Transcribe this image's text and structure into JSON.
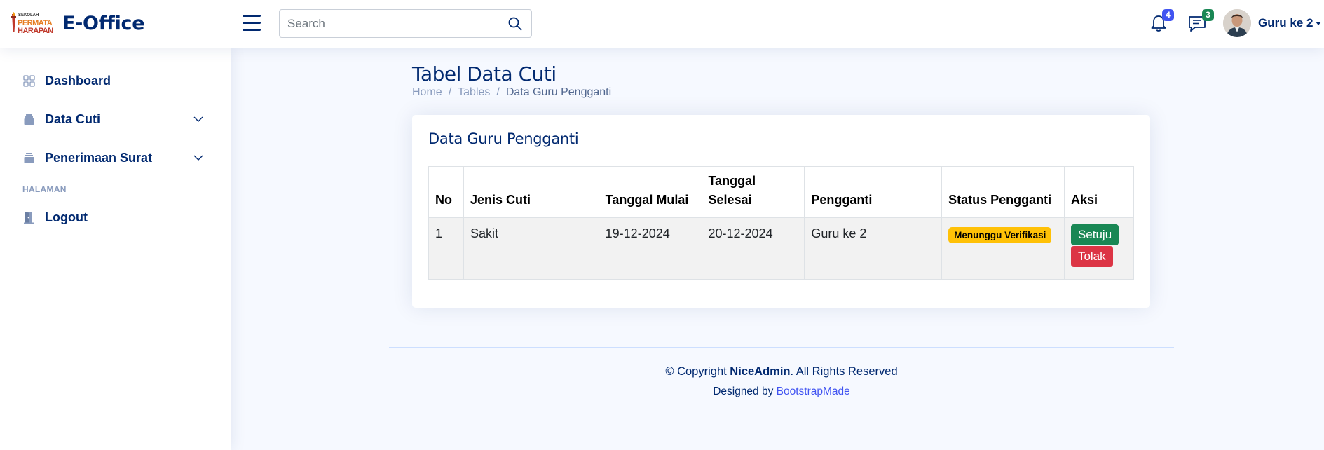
{
  "header": {
    "brand": "E-Office",
    "logo_top": "SEKOLAH",
    "logo_mid": "PERMATA",
    "logo_bottom": "HARAPAN",
    "search_placeholder": "Search",
    "notifications_count": "4",
    "messages_count": "3",
    "user_name": "Guru ke 2"
  },
  "sidebar": {
    "items": [
      {
        "label": "Dashboard",
        "icon": "grid-icon"
      },
      {
        "label": "Data Cuti",
        "icon": "layers-icon"
      },
      {
        "label": "Penerimaan Surat",
        "icon": "layers-icon"
      }
    ],
    "heading": "HALAMAN",
    "logout_label": "Logout"
  },
  "page": {
    "title": "Tabel Data Cuti",
    "breadcrumb": [
      "Home",
      "Tables",
      "Data Guru Pengganti"
    ]
  },
  "card": {
    "title": "Data Guru Pengganti",
    "columns": [
      "No",
      "Jenis Cuti",
      "Tanggal Mulai",
      "Tanggal Selesai",
      "Pengganti",
      "Status Pengganti",
      "Aksi"
    ],
    "rows": [
      {
        "no": "1",
        "jenis_cuti": "Sakit",
        "tanggal_mulai": "19-12-2024",
        "tanggal_selesai": "20-12-2024",
        "pengganti": "Guru ke 2",
        "status": "Menunggu Verifikasi",
        "approve_label": "Setuju",
        "reject_label": "Tolak"
      }
    ]
  },
  "footer": {
    "copyright_prefix": "© Copyright ",
    "brand": "NiceAdmin",
    "copyright_suffix": ". All Rights Reserved",
    "designed_by": "Designed by ",
    "designer": "BootstrapMade"
  },
  "colors": {
    "primary": "#012970",
    "accent": "#4154f1",
    "background": "#f6f9ff",
    "status_warning": "#ffc107",
    "success": "#198754",
    "danger": "#dc3545"
  }
}
